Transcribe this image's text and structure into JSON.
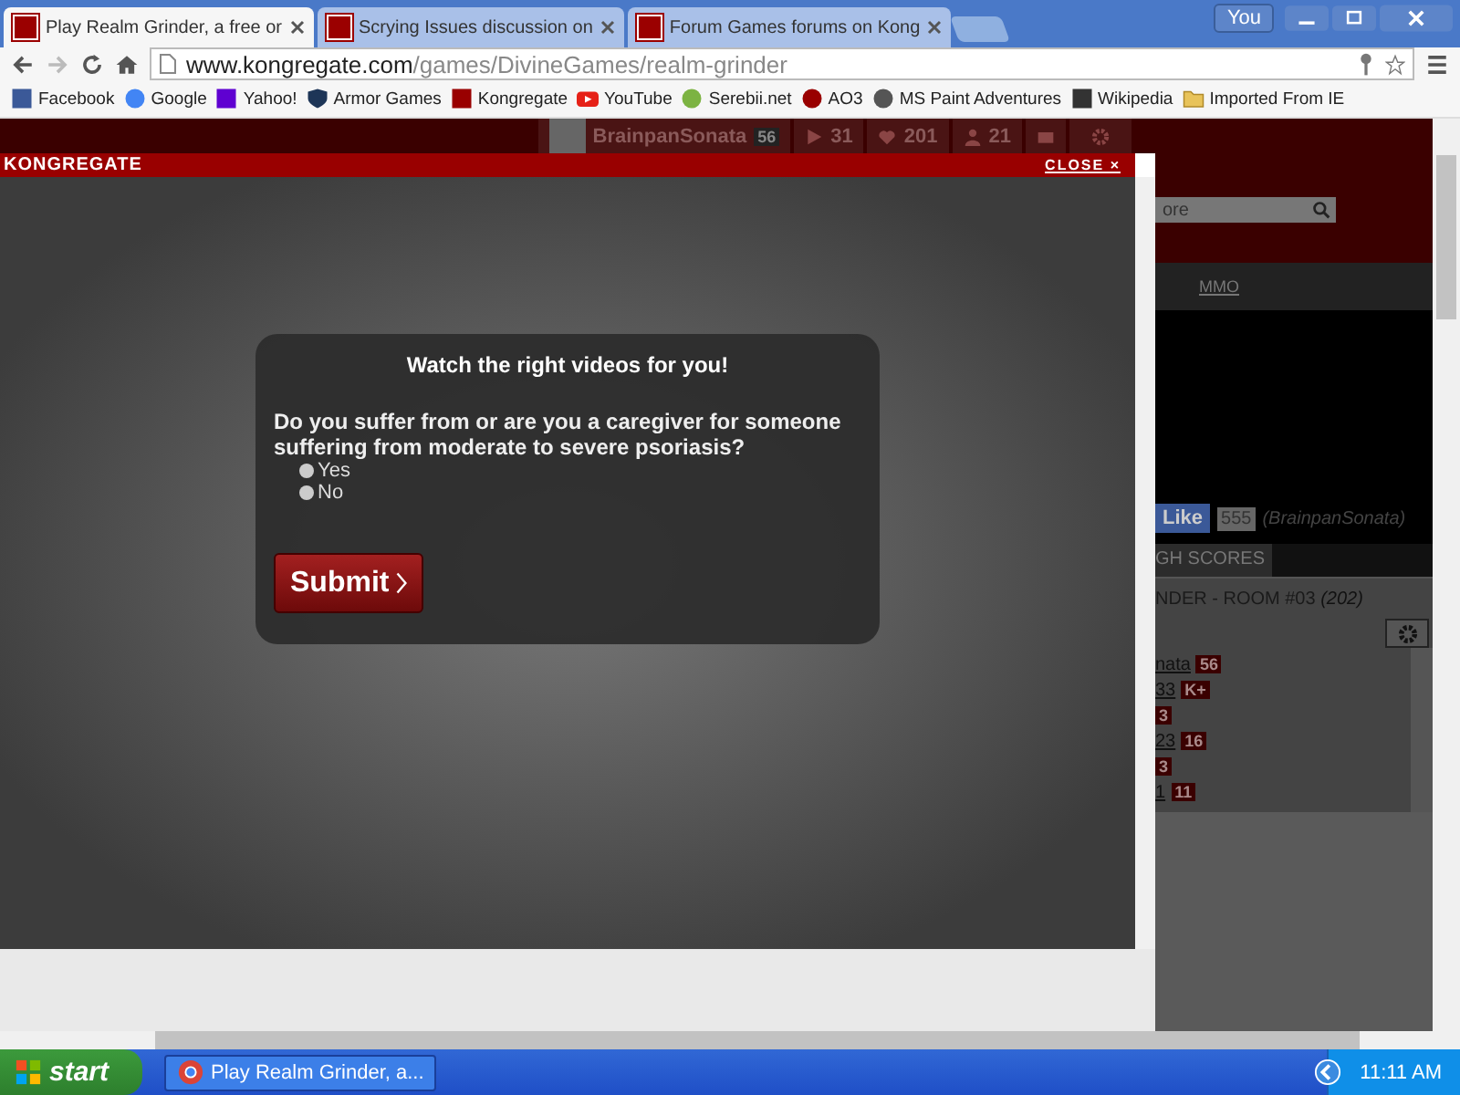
{
  "browser": {
    "tabs": [
      {
        "title": "Play Realm Grinder, a free or",
        "selected": true
      },
      {
        "title": "Scrying Issues discussion on",
        "selected": false
      },
      {
        "title": "Forum Games forums on Kong",
        "selected": false
      }
    ],
    "profile": "You",
    "address": {
      "host": "www.kongregate.com",
      "path": "/games/DivineGames/realm-grinder"
    },
    "bookmarks": [
      {
        "label": "Facebook",
        "kind": "square",
        "color": "#3b5998"
      },
      {
        "label": "Google",
        "kind": "circle",
        "color": "#4285f4"
      },
      {
        "label": "Yahoo!",
        "kind": "square",
        "color": "#5f01d1"
      },
      {
        "label": "Armor Games",
        "kind": "shield",
        "color": "#1d3557"
      },
      {
        "label": "Kongregate",
        "kind": "square",
        "color": "#990000"
      },
      {
        "label": "YouTube",
        "kind": "play",
        "color": "#e62117"
      },
      {
        "label": "Serebii.net",
        "kind": "circle",
        "color": "#7cb342"
      },
      {
        "label": "AO3",
        "kind": "circle",
        "color": "#990000"
      },
      {
        "label": "MS Paint Adventures",
        "kind": "circle",
        "color": "#555555"
      },
      {
        "label": "Wikipedia",
        "kind": "square",
        "color": "#333333"
      },
      {
        "label": "Imported From IE",
        "kind": "folder",
        "color": "#e8c35a"
      }
    ]
  },
  "site": {
    "user": "BrainpanSonata",
    "level": "56",
    "stats": [
      {
        "kind": "play",
        "value": "31"
      },
      {
        "kind": "heart",
        "value": "201"
      },
      {
        "kind": "person",
        "value": "21"
      }
    ],
    "search_partial": "ore",
    "nav_link": "MMO",
    "like": "Like",
    "like_count": "555",
    "username_partial": "(BrainpanSonata)",
    "tab_partial": "GH SCORES",
    "room": "NDER - ROOM #03",
    "room_count": "(202)",
    "chat_users": [
      {
        "name": "nata",
        "badge": "56"
      },
      {
        "name": "33",
        "badge": "K+"
      },
      {
        "badge": "3"
      },
      {
        "name": "23",
        "badge": "16"
      },
      {
        "badge": "3"
      },
      {
        "name": "1",
        "badge": "11"
      }
    ]
  },
  "overlay": {
    "brand": "KONGREGATE",
    "close": "CLOSE ×",
    "heading": "Watch the right videos for you!",
    "question": "Do you suffer from or are you a caregiver for someone suffering from moderate to severe psoriasis?",
    "options": [
      {
        "label": "Yes",
        "selected": false
      },
      {
        "label": "No",
        "selected": false
      }
    ],
    "submit": "Submit"
  },
  "taskbar": {
    "start": "start",
    "task": "Play Realm Grinder, a...",
    "clock": "11:11 AM"
  }
}
